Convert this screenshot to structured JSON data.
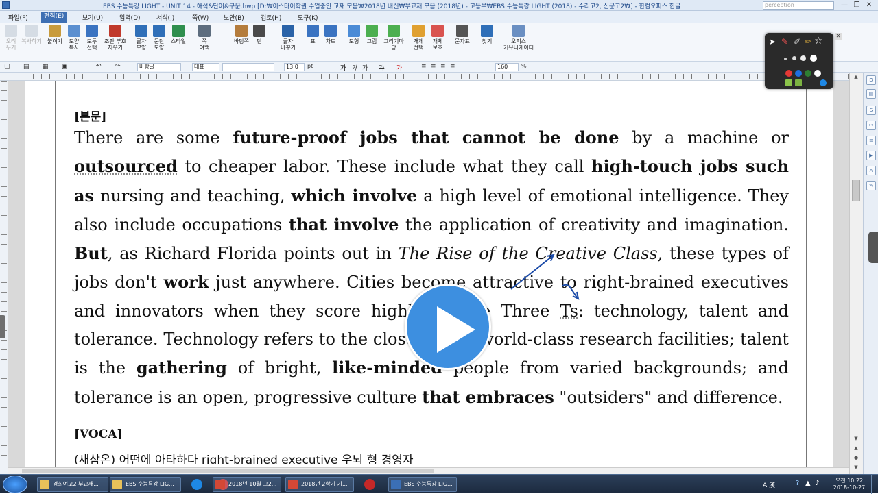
{
  "window": {
    "title": "EBS 수능특강 LIGHT - UNIT 14 - 해석&단어&구문.hwp [D:₩이스타이학원 수업중인 교재 모음₩2018년 내신₩부교재 모음 (2018년) - 고등부₩EBS 수능특강 LIGHT (2018) - 수리고2, 신문고2₩] - 한컴오피스 한글",
    "search_placeholder": "perception",
    "min_label": "—",
    "restore_label": "❐",
    "close_label": "✕"
  },
  "menubar": {
    "items": [
      "파일(F)",
      "편집(E)",
      "보기(U)",
      "입력(D)",
      "서식(J)",
      "쪽(W)",
      "보안(B)",
      "검토(H)",
      "도구(K)"
    ],
    "active": "편집(E)"
  },
  "ribbon": {
    "buttons": [
      {
        "label": "오려\n두기",
        "enabled": false,
        "color": "#9aa9bb"
      },
      {
        "label": "복사하기",
        "enabled": false,
        "color": "#9aa9bb"
      },
      {
        "label": "붙이기",
        "enabled": true,
        "color": "#c89b3c"
      },
      {
        "label": "모양\n복사",
        "enabled": true,
        "color": "#5b8fd0"
      },
      {
        "label": "모두\n선택",
        "enabled": true,
        "color": "#3a73c1"
      },
      {
        "label": "조판 부호\n지우기",
        "enabled": true,
        "color": "#c0392b"
      },
      {
        "label": "글자\n모양",
        "enabled": true,
        "color": "#2f6fb8"
      },
      {
        "label": "문단\n모양",
        "enabled": true,
        "color": "#2f6fb8"
      },
      {
        "label": "스타일",
        "enabled": true,
        "color": "#2f8f4e"
      },
      {
        "label": "쪽\n여백",
        "enabled": true,
        "color": "#5d6d7e"
      },
      {
        "label": "바탕쪽",
        "enabled": true,
        "color": "#b47c3c"
      },
      {
        "label": "단",
        "enabled": true,
        "color": "#4a4a4a"
      },
      {
        "label": "글자\n바꾸기",
        "enabled": true,
        "color": "#2a63a8"
      },
      {
        "label": "표",
        "enabled": true,
        "color": "#3a73c1"
      },
      {
        "label": "차트",
        "enabled": true,
        "color": "#3a73c1"
      },
      {
        "label": "도형",
        "enabled": true,
        "color": "#4b8bd6"
      },
      {
        "label": "그림",
        "enabled": true,
        "color": "#4caf50"
      },
      {
        "label": "그리기마당",
        "enabled": true,
        "color": "#4caf50"
      },
      {
        "label": "개체\n선택",
        "enabled": true,
        "color": "#e0a030"
      },
      {
        "label": "개체\n보호",
        "enabled": true,
        "color": "#d9534f"
      },
      {
        "label": "문자표",
        "enabled": true,
        "color": "#555555"
      },
      {
        "label": "찾기",
        "enabled": true,
        "color": "#2f6fb8"
      },
      {
        "label": "오피스\n커뮤니케이터",
        "enabled": true,
        "color": "#6a8fc2"
      }
    ]
  },
  "formatbar": {
    "style": "바탕글",
    "lang": "대표",
    "font": "",
    "size": "13.0",
    "size_unit": "pt",
    "bold": "가",
    "italic": "가",
    "underline": "가",
    "strike": "가",
    "color": "가",
    "zoom": "160",
    "zoom_unit": "%"
  },
  "document": {
    "section_label": "[본문]",
    "voca_label": "[VOCA]",
    "voca_partial": "(새삼온) 어떤에 아타하다            right-brained executive      우뇌 형 경영자"
  },
  "body": {
    "s1a": "There are some ",
    "s1b": "future-proof jobs that cannot be done",
    "s1c": " by a machine or ",
    "s1d": "outsourced",
    "s1e": " to cheaper labor. These include what they call ",
    "s1f": "high-touch jobs such as",
    "s1g": " nursing and teaching, ",
    "s1h": "which involve",
    "s1i": " a high level of emotional intelligence. They also include occupations ",
    "s1j": "that involve",
    "s1k": " the application of creativity and imagination. ",
    "s1l": "But",
    "s1m": ", as Richard Florida points out in ",
    "s1n": "The Rise of the Creative Class",
    "s1o": ", these types of jobs don't ",
    "s1p": "work",
    "s1q": " just anywhere. Cities become attractive to right-brained executives and innovators when they score highly on the Three ",
    "s1r": "Ts",
    "s1s": ": technology, talent and tolerance. Technology refers to the closeness of world-class research facilities; talent is the ",
    "s1t": "gathering",
    "s1u": " of bright, ",
    "s1v": "like-minded",
    "s1w": " people from varied backgrounds; and tolerance is an open, progressive culture ",
    "s1x": "that embraces",
    "s1y": " \"outsiders\" and difference."
  },
  "taskbar": {
    "tasks": [
      {
        "label": "경희여고2 부교재...",
        "color": "#e8c15a"
      },
      {
        "label": "EBS 수능특강 LIG...",
        "color": "#e8c15a"
      },
      {
        "label": "2018년 10월 고2...",
        "color": "#d34836"
      },
      {
        "label": "2018년 2학기 기...",
        "color": "#d34836"
      },
      {
        "label": "EBS 수능특강 LIG...",
        "color": "#3b6fb6"
      }
    ],
    "tray_lang": "A 漢",
    "time_ampm": "오전 10:22",
    "date": "2018-10-27"
  },
  "colors": {
    "play_button": "#3d8fe0",
    "ink": "#1a4aa8",
    "menu_active": "#3e6fb3"
  }
}
